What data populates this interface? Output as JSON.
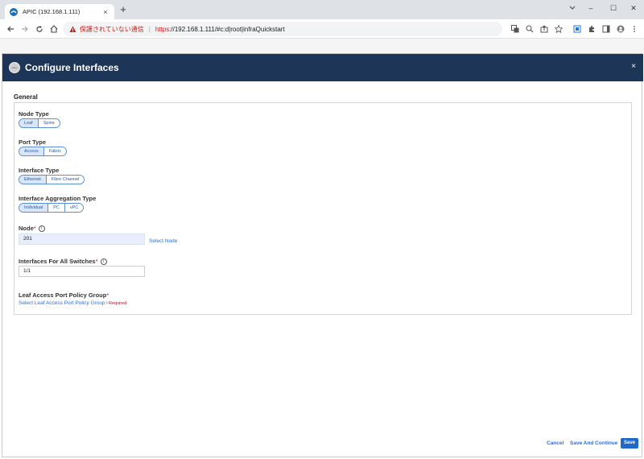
{
  "browser": {
    "tab_title": "APIC (192.168.1.111)",
    "tab_close": "×",
    "new_tab": "+",
    "window_controls": {
      "minimize": "–",
      "maximize": "☐",
      "close": "✕"
    },
    "security_warning": "保護されていない通信",
    "url_scheme": "https",
    "url_rest": "://192.168.1.111/#c:d|root|infraQuickstart"
  },
  "dialog": {
    "title": "Configure Interfaces",
    "logo_text": "cisco",
    "close": "×",
    "section_title": "General",
    "node_type": {
      "label": "Node Type",
      "options": [
        "Leaf",
        "Spine"
      ],
      "selected": "Leaf"
    },
    "port_type": {
      "label": "Port Type",
      "options": [
        "Access",
        "Fabric"
      ],
      "selected": "Access"
    },
    "interface_type": {
      "label": "Interface Type",
      "options": [
        "Ethernet",
        "Fibre Channel"
      ],
      "selected": "Ethernet"
    },
    "aggregation_type": {
      "label": "Interface Aggregation Type",
      "options": [
        "Individual",
        "PC",
        "vPC"
      ],
      "selected": "Individual"
    },
    "node": {
      "label": "Node",
      "required_mark": "*",
      "info": "i",
      "value": "201",
      "select_link": "Select Node"
    },
    "interfaces": {
      "label": "Interfaces For All Switches",
      "required_mark": "*",
      "info": "i",
      "value": "1/1"
    },
    "policy_group": {
      "label": "Leaf Access Port Policy Group",
      "required_mark": "*",
      "select_link": "Select Leaf Access Port Policy Group",
      "chevron": "›",
      "required_note": "Required"
    },
    "footer": {
      "cancel": "Cancel",
      "save_continue": "Save And Continue",
      "save": "Save"
    }
  },
  "colors": {
    "header_bg": "#1d3557",
    "accent": "#2e6fd1",
    "warning": "#c5221f"
  }
}
